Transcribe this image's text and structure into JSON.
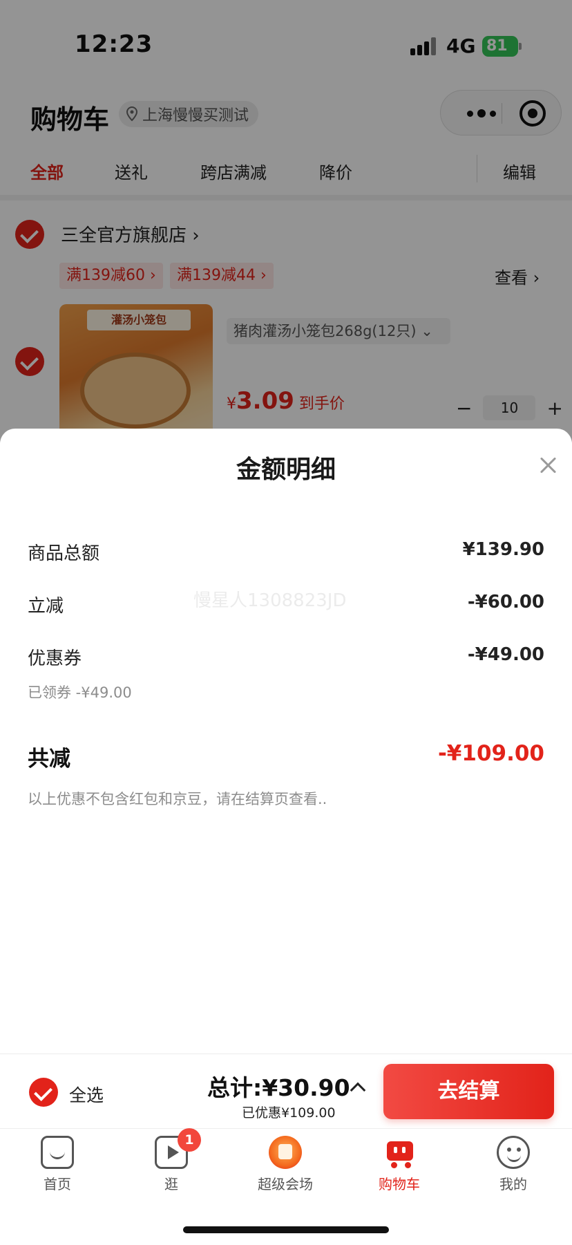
{
  "status_bar": {
    "time": "12:23",
    "network": "4G",
    "battery": "81"
  },
  "header": {
    "title": "购物车",
    "location": "上海慢慢买测试"
  },
  "tabs": [
    {
      "label": "全部",
      "active": true
    },
    {
      "label": "送礼",
      "active": false
    },
    {
      "label": "跨店满减",
      "active": false
    },
    {
      "label": "降价",
      "active": false
    },
    {
      "label": "编辑",
      "active": false
    }
  ],
  "shop": {
    "name": "三全官方旗舰店",
    "promos": [
      "满139减60",
      "满139减44"
    ],
    "view_label": "查看"
  },
  "product": {
    "image_label": "灌汤小笼包",
    "variant": "猪肉灌汤小笼包268g(12只)",
    "price_symbol": "¥",
    "price": "3.09",
    "price_note": "到手价",
    "quantity": "10"
  },
  "sheet": {
    "title": "金额明细",
    "watermark": "慢星人1308823JD",
    "rows": [
      {
        "label": "商品总额",
        "value": "¥139.90"
      },
      {
        "label": "立减",
        "value": "-¥60.00"
      },
      {
        "label": "优惠券",
        "value": "-¥49.00"
      }
    ],
    "coupon_note": "已领券 -¥49.00",
    "total_label": "共减",
    "total_value": "-¥109.00",
    "footnote": "以上优惠不包含红包和京豆，请在结算页查看.."
  },
  "checkout": {
    "select_all": "全选",
    "total": "总计:¥30.90",
    "saved": "已优惠¥109.00",
    "button": "去结算"
  },
  "nav": [
    {
      "label": "首页"
    },
    {
      "label": "逛",
      "badge": "1"
    },
    {
      "label": "超级会场"
    },
    {
      "label": "购物车",
      "active": true
    },
    {
      "label": "我的"
    }
  ],
  "colors": {
    "accent": "#e2231a",
    "battery": "#35c759"
  }
}
